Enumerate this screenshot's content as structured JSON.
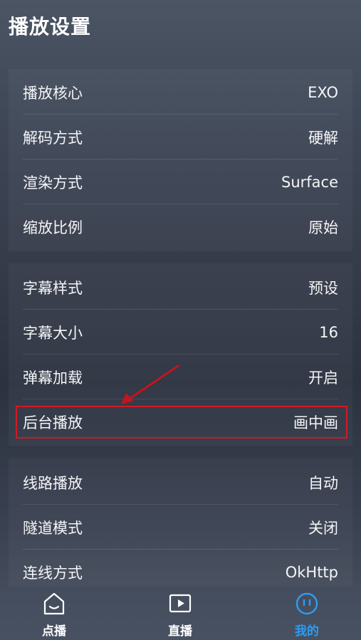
{
  "header": {
    "title": "播放设置"
  },
  "groups": [
    {
      "rows": [
        {
          "label": "播放核心",
          "value": "EXO"
        },
        {
          "label": "解码方式",
          "value": "硬解"
        },
        {
          "label": "渲染方式",
          "value": "Surface"
        },
        {
          "label": "缩放比例",
          "value": "原始"
        }
      ]
    },
    {
      "rows": [
        {
          "label": "字幕样式",
          "value": "预设"
        },
        {
          "label": "字幕大小",
          "value": "16"
        },
        {
          "label": "弹幕加载",
          "value": "开启"
        },
        {
          "label": "后台播放",
          "value": "画中画"
        }
      ]
    },
    {
      "rows": [
        {
          "label": "线路播放",
          "value": "自动"
        },
        {
          "label": "隧道模式",
          "value": "关闭"
        },
        {
          "label": "连线方式",
          "value": "OkHttp"
        }
      ]
    }
  ],
  "bottom_nav": {
    "tabs": [
      {
        "label": "点播",
        "icon": "home-face-icon"
      },
      {
        "label": "直播",
        "icon": "play-box-icon"
      },
      {
        "label": "我的",
        "icon": "face-circle-icon",
        "active": true
      }
    ]
  },
  "colors": {
    "active_tab": "#2a9df4",
    "highlight_box": "#d01a25",
    "annotation_arrow": "#c2151f"
  }
}
